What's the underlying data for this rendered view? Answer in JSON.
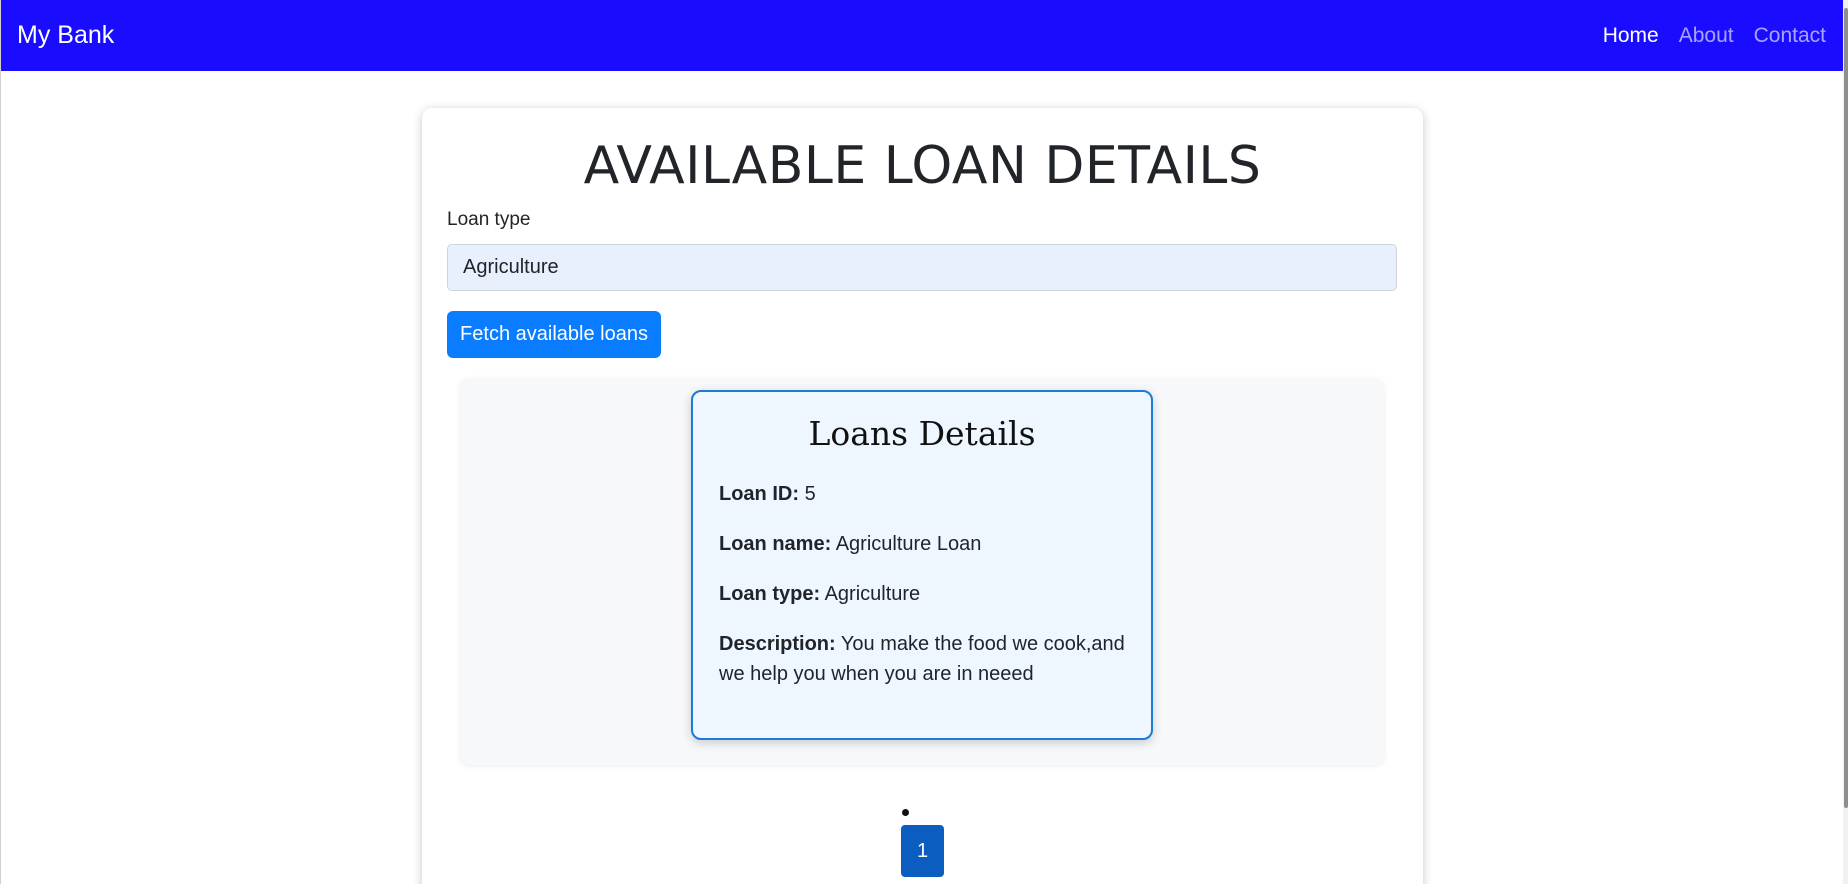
{
  "navbar": {
    "brand": "My Bank",
    "links": [
      {
        "label": "Home",
        "active": true
      },
      {
        "label": "About",
        "active": false
      },
      {
        "label": "Contact",
        "active": false
      }
    ],
    "bg_color": "#1a0dff"
  },
  "page": {
    "title": "AVAILABLE LOAN DETAILS",
    "loan_type_label": "Loan type",
    "loan_type_value": "Agriculture",
    "fetch_button_label": "Fetch available loans"
  },
  "loan_card": {
    "title": "Loans Details",
    "id_label": "Loan ID:",
    "id_value": "5",
    "name_label": "Loan name:",
    "name_value": "Agriculture Loan",
    "type_label": "Loan type:",
    "type_value": "Agriculture",
    "description_label": "Description:",
    "description_value": "You make the food we cook,and we help you when you are in neeed"
  },
  "pagination": {
    "pages": [
      "1"
    ],
    "current": "1"
  },
  "colors": {
    "button": "#0a7cff",
    "card_border": "#1b7bd6",
    "page_active": "#0b5ebf"
  }
}
